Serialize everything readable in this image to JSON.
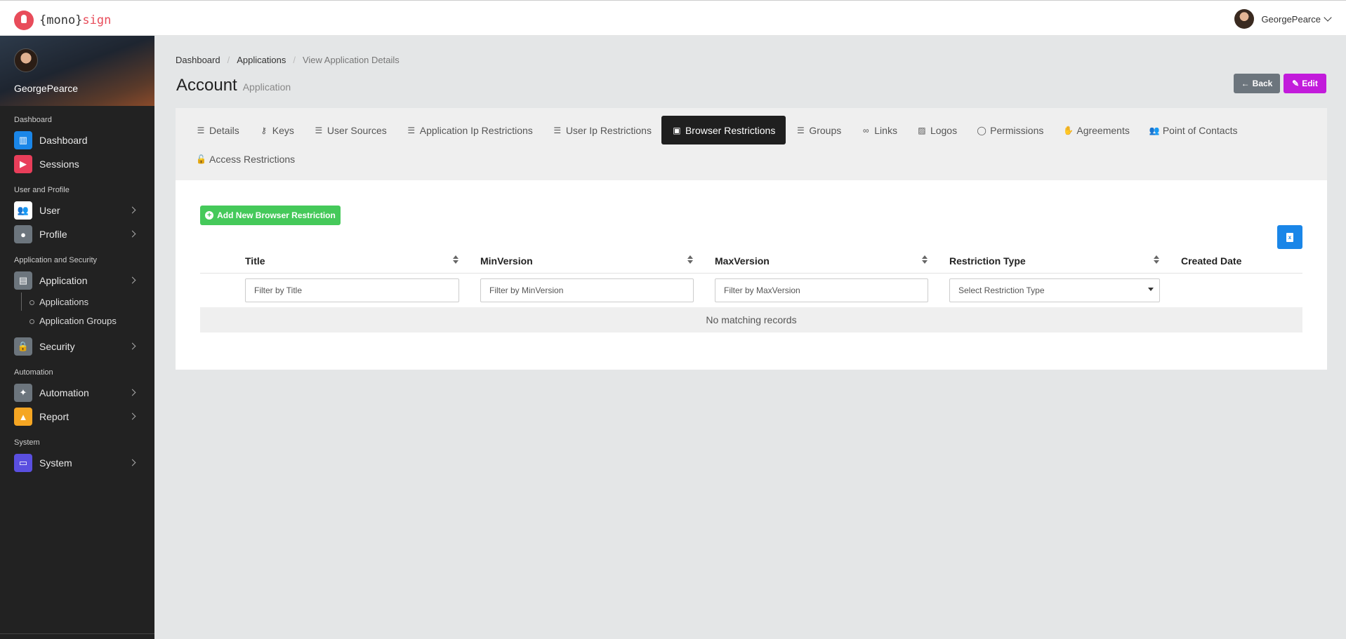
{
  "topbar": {
    "logo_prefix": "{mono}",
    "logo_brand": "sign",
    "username": "GeorgePearce"
  },
  "sidebar": {
    "username": "GeorgePearce",
    "sections": {
      "dashboard": "Dashboard",
      "user_profile": "User and Profile",
      "app_security": "Application and Security",
      "automation": "Automation",
      "system": "System"
    },
    "items": {
      "dashboard": "Dashboard",
      "sessions": "Sessions",
      "user": "User",
      "profile": "Profile",
      "application": "Application",
      "applications": "Applications",
      "application_groups": "Application Groups",
      "security": "Security",
      "automation": "Automation",
      "report": "Report",
      "system": "System"
    },
    "colors": {
      "dashboard": "#1a86e8",
      "sessions": "#e83e5a",
      "user": "#ffffff",
      "profile": "#6c757d",
      "application": "#6c757d",
      "security": "#6c757d",
      "automation": "#6c757d",
      "report": "#f5a623",
      "system": "#5a4fe0"
    }
  },
  "breadcrumb": [
    "Dashboard",
    "Applications",
    "View Application Details"
  ],
  "page": {
    "title": "Account",
    "subtitle": "Application",
    "back_label": "Back",
    "edit_label": "Edit"
  },
  "tabs": [
    {
      "label": "Details",
      "icon": "list-icon",
      "glyph": "☰",
      "active": false
    },
    {
      "label": "Keys",
      "icon": "key-icon",
      "glyph": "⚷",
      "active": false
    },
    {
      "label": "User Sources",
      "icon": "list-icon",
      "glyph": "☰",
      "active": false
    },
    {
      "label": "Application Ip Restrictions",
      "icon": "list-icon",
      "glyph": "☰",
      "active": false
    },
    {
      "label": "User Ip Restrictions",
      "icon": "list-icon",
      "glyph": "☰",
      "active": false
    },
    {
      "label": "Browser Restrictions",
      "icon": "browser-icon",
      "glyph": "▣",
      "active": true
    },
    {
      "label": "Groups",
      "icon": "list-icon",
      "glyph": "☰",
      "active": false
    },
    {
      "label": "Links",
      "icon": "link-icon",
      "glyph": "∞",
      "active": false
    },
    {
      "label": "Logos",
      "icon": "images-icon",
      "glyph": "▨",
      "active": false
    },
    {
      "label": "Permissions",
      "icon": "toggle-icon",
      "glyph": "◯",
      "active": false
    },
    {
      "label": "Agreements",
      "icon": "handshake-icon",
      "glyph": "✋",
      "active": false
    },
    {
      "label": "Point of Contacts",
      "icon": "users-icon",
      "glyph": "👥",
      "active": false
    },
    {
      "label": "Access Restrictions",
      "icon": "unlock-icon",
      "glyph": "🔓",
      "active": false
    }
  ],
  "content": {
    "add_button": "Add New Browser Restriction",
    "columns": [
      "Title",
      "MinVersion",
      "MaxVersion",
      "Restriction Type",
      "Created Date"
    ],
    "filters": {
      "title_placeholder": "Filter by Title",
      "min_placeholder": "Filter by MinVersion",
      "max_placeholder": "Filter by MaxVersion",
      "type_placeholder": "Select Restriction Type"
    },
    "empty_message": "No matching records"
  }
}
